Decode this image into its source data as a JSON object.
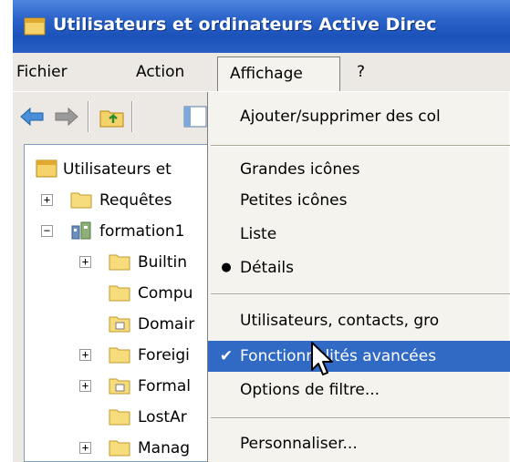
{
  "window": {
    "title": "Utilisateurs et ordinateurs Active Direc"
  },
  "menubar": {
    "items": [
      "Fichier",
      "Action",
      "Affichage",
      "?"
    ]
  },
  "toolbar": {
    "buttons": [
      "back-arrow-icon",
      "forward-arrow-icon",
      "up-folder-icon",
      "view-icon"
    ]
  },
  "tree": {
    "items": [
      {
        "label": "Utilisateurs et",
        "expander": ""
      },
      {
        "label": "Requêtes",
        "expander": "+"
      },
      {
        "label": "formation1",
        "expander": "−"
      },
      {
        "label": "Builtin",
        "expander": "+"
      },
      {
        "label": "Compu",
        "expander": ""
      },
      {
        "label": "Domair",
        "expander": ""
      },
      {
        "label": "Foreigi",
        "expander": "+"
      },
      {
        "label": "Formal",
        "expander": "+"
      },
      {
        "label": "LostAr",
        "expander": ""
      },
      {
        "label": "Manag",
        "expander": "+"
      }
    ]
  },
  "dropdown": {
    "items": [
      {
        "label": "Ajouter/supprimer des col",
        "mark": ""
      },
      {
        "label": "Grandes icônes",
        "mark": ""
      },
      {
        "label": "Petites icônes",
        "mark": ""
      },
      {
        "label": "Liste",
        "mark": ""
      },
      {
        "label": "Détails",
        "mark": "●"
      },
      {
        "label": "Utilisateurs, contacts, gro",
        "mark": ""
      },
      {
        "label": "Fonctionnalités avancées",
        "mark": "✔"
      },
      {
        "label": "Options de filtre...",
        "mark": ""
      },
      {
        "label": "Personnaliser...",
        "mark": ""
      }
    ]
  },
  "colors": {
    "title_bar": "#2b63c9",
    "menu_highlight": "#316ac5",
    "menu_background": "#f4f3ee"
  }
}
